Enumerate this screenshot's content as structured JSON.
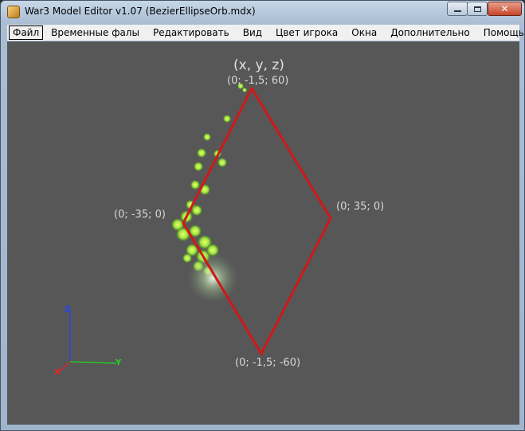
{
  "window": {
    "title": "War3 Model Editor v1.07 (BezierEllipseOrb.mdx)",
    "controls": {
      "minimize": "",
      "maximize": "",
      "close": "✕"
    }
  },
  "menu": {
    "items": [
      {
        "label": "Файл",
        "active": true
      },
      {
        "label": "Временные фалы",
        "active": false
      },
      {
        "label": "Редактировать",
        "active": false
      },
      {
        "label": "Вид",
        "active": false
      },
      {
        "label": "Цвет игрока",
        "active": false
      },
      {
        "label": "Окна",
        "active": false
      },
      {
        "label": "Дополнительно",
        "active": false
      },
      {
        "label": "Помощь",
        "active": false
      }
    ]
  },
  "viewport": {
    "header": "(x, y, z)",
    "labels": {
      "top": "(0; -1,5; 60)",
      "left": "(0; -35; 0)",
      "right": "(0; 35; 0)",
      "bottom": "(0; -1,5; -60)"
    },
    "axes": {
      "z": "Z",
      "y": "Y",
      "x": "X"
    },
    "colors": {
      "background": "#575757",
      "diamond": "#d01818",
      "particles": "#9be23a",
      "axis_z": "#2244ff",
      "axis_y": "#22dd22",
      "axis_x": "#ee2222"
    }
  }
}
